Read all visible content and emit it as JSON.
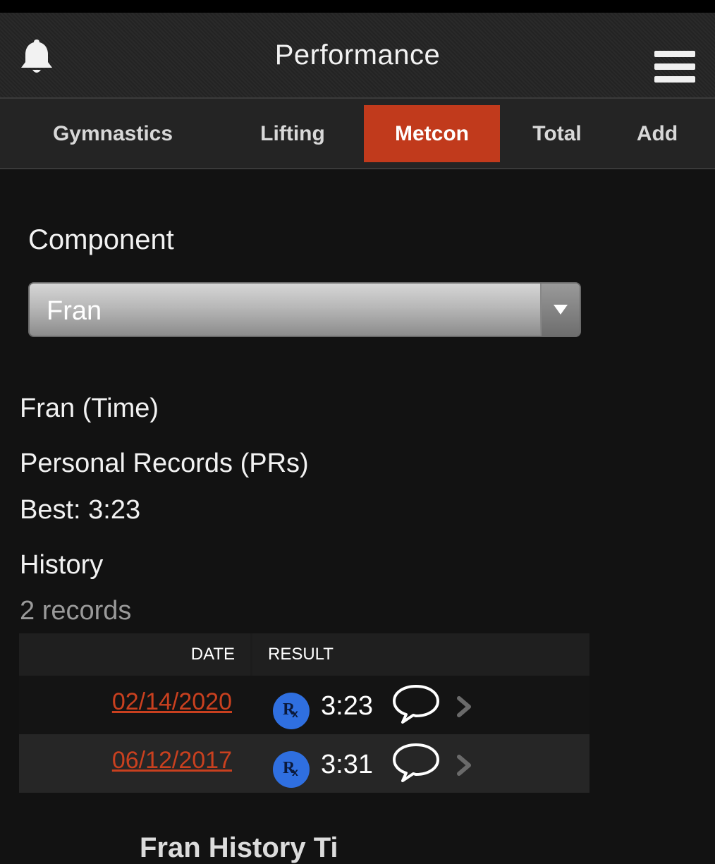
{
  "header": {
    "title": "Performance"
  },
  "tabs": [
    {
      "label": "Gymnastics"
    },
    {
      "label": "Lifting"
    },
    {
      "label": "Metcon",
      "active": true
    },
    {
      "label": "Total"
    },
    {
      "label": "Add"
    }
  ],
  "component": {
    "label": "Component",
    "selected": "Fran"
  },
  "workout": {
    "title": "Fran (Time)",
    "pr_heading": "Personal Records (PRs)",
    "best": "Best: 3:23"
  },
  "history": {
    "heading": "History",
    "count": "2 records",
    "columns": {
      "date": "DATE",
      "result": "RESULT"
    },
    "rows": [
      {
        "date": "02/14/2020",
        "badge": "Rx",
        "result": "3:23"
      },
      {
        "date": "06/12/2017",
        "badge": "Rx",
        "result": "3:31"
      }
    ]
  },
  "footer_peek": "Fran History      Ti",
  "colors": {
    "accent": "#c13a1c",
    "link": "#c9401f",
    "rx_badge": "#2f6fe0",
    "background": "#121212"
  },
  "icons": {
    "notifications": "bell-icon",
    "menu": "hamburger-menu-icon",
    "dropdown": "caret-down-icon",
    "comment": "speech-bubble-icon",
    "row_nav": "chevron-right-icon"
  }
}
